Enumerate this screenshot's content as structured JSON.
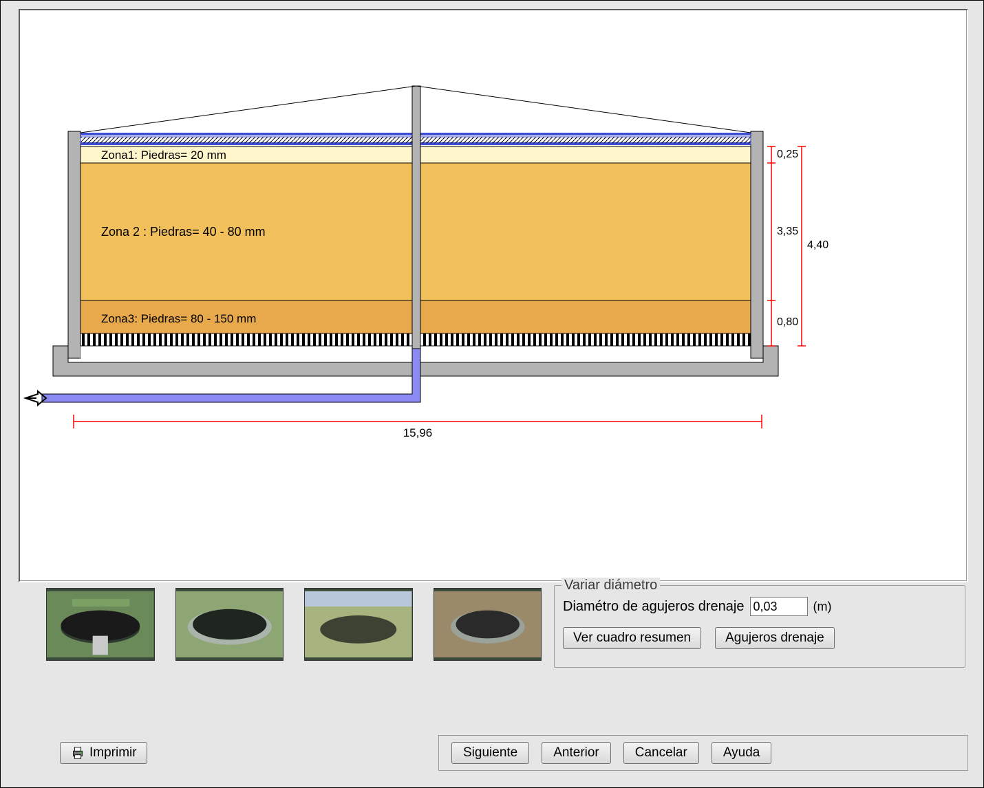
{
  "diagram": {
    "zone1_label": "Zona1:    Piedras= 20 mm",
    "zone2_label": "Zona 2 :   Piedras= 40 - 80 mm",
    "zone3_label": "Zona3:    Piedras=  80 - 150 mm",
    "width_label": "15,96",
    "height_top_label": "0,25",
    "height_mid_label": "3,35",
    "height_bot_label": "0,80",
    "height_total_label": "4,40",
    "colors": {
      "zone1": "#fff6cc",
      "zone2": "#f2c05a",
      "zone3": "#e7a94c",
      "concrete": "#b3b3b3",
      "pipe": "#8a8af2",
      "dim": "#ff0000"
    }
  },
  "thumbs": [
    "filter-photo-1",
    "filter-photo-2",
    "filter-photo-3",
    "filter-photo-4"
  ],
  "panel": {
    "legend": "Variar diámetro",
    "diameter_label": "Diamétro de agujeros drenaje",
    "diameter_value": "0,03",
    "unit": "(m)",
    "btn_summary": "Ver cuadro resumen",
    "btn_drain": "Agujeros drenaje"
  },
  "buttons": {
    "print": "Imprimir",
    "next": "Siguiente",
    "prev": "Anterior",
    "cancel": "Cancelar",
    "help": "Ayuda"
  }
}
